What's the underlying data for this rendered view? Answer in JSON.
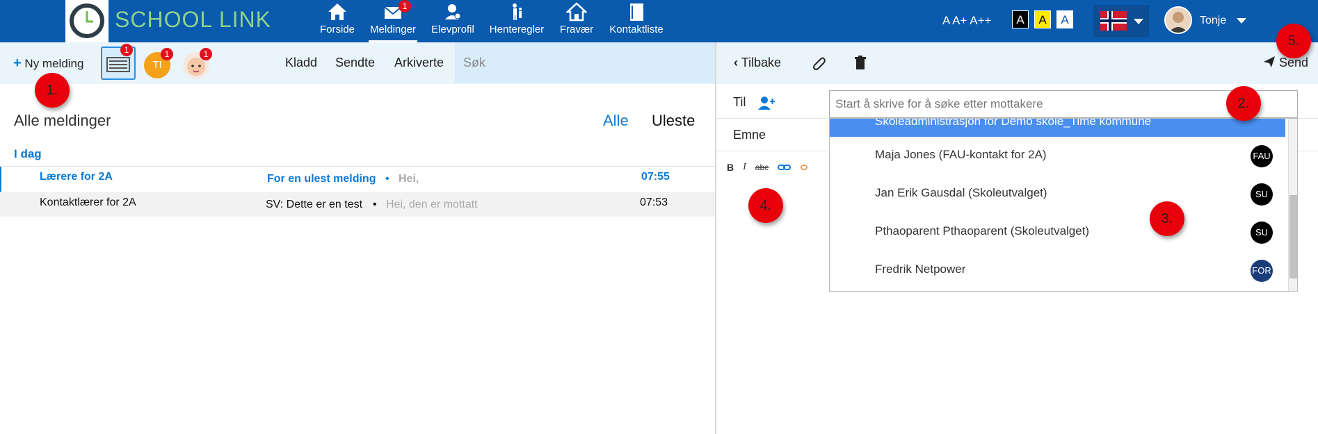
{
  "app": {
    "logo_text": "SCHOOL LINK"
  },
  "nav": [
    {
      "label": "Forside",
      "icon": "home-icon"
    },
    {
      "label": "Meldinger",
      "icon": "envelope-icon",
      "badge": "1"
    },
    {
      "label": "Elevprofil",
      "icon": "student-icon"
    },
    {
      "label": "Henteregler",
      "icon": "pickup-icon"
    },
    {
      "label": "Fravær",
      "icon": "absence-home-icon"
    },
    {
      "label": "Kontaktliste",
      "icon": "contact-book-icon"
    }
  ],
  "accessibility": {
    "font_sizes": "A A+ A++",
    "contrast_a": "A",
    "contrast_b": "A",
    "contrast_c": "A"
  },
  "user": {
    "name": "Tonje"
  },
  "left_toolbar": {
    "new_message": "Ny melding",
    "inbox_badge": "1",
    "ti_label": "TI",
    "ti_badge": "1",
    "child_badge": "1",
    "tabs": [
      "Kladd",
      "Sendte",
      "Arkiverte"
    ],
    "search_placeholder": "Søk"
  },
  "messages": {
    "title": "Alle meldinger",
    "filter_all": "Alle",
    "filter_unread": "Uleste",
    "group_today": "I dag",
    "rows": [
      {
        "sender": "Lærere for 2A",
        "subject": "For en ulest melding",
        "sep": "•",
        "preview": "Hei,",
        "time": "07:55",
        "unread": true
      },
      {
        "sender": "Kontaktlærer for 2A",
        "subject": "SV: Dette er en test",
        "sep": "•",
        "preview": "Hei, den er mottatt",
        "time": "07:53",
        "unread": false
      }
    ]
  },
  "compose": {
    "back": "Tilbake",
    "send": "Send",
    "to_label": "Til",
    "subject_label": "Emne",
    "recipient_placeholder": "Start å skrive for å søke etter mottakere",
    "dropdown_items": [
      {
        "label": "Skoleadministrasjon for Demo skole_Time kommune",
        "chip": ""
      },
      {
        "label": "Maja Jones (FAU-kontakt for 2A)",
        "chip": "FAU"
      },
      {
        "label": "Jan Erik Gausdal (Skoleutvalget)",
        "chip": "SU"
      },
      {
        "label": "Pthaoparent Pthaoparent (Skoleutvalget)",
        "chip": "SU"
      },
      {
        "label": "Fredrik Netpower",
        "chip": "FOR"
      }
    ]
  },
  "markers": [
    "1.",
    "2.",
    "3.",
    "4.",
    "5."
  ],
  "colors": {
    "brand": "#0a5aad",
    "accent": "#0a7ad8",
    "badge": "#e0101e",
    "selected": "#4a8ff0"
  }
}
